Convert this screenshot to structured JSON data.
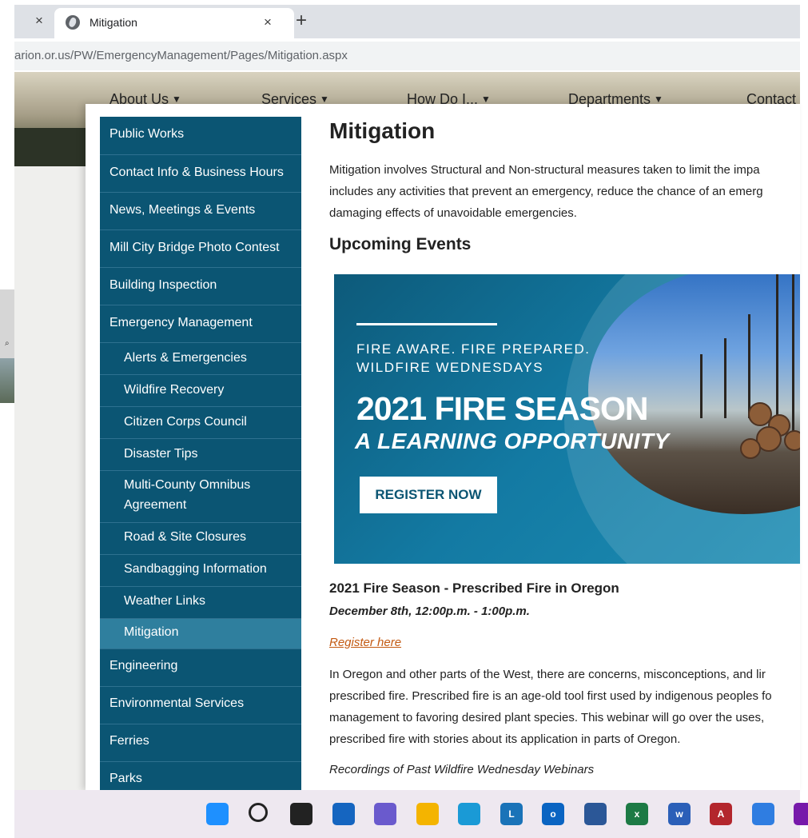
{
  "browser": {
    "tab_title": "Mitigation",
    "close_glyph": "×",
    "new_tab_glyph": "+",
    "url": "arion.or.us/PW/EmergencyManagement/Pages/Mitigation.aspx"
  },
  "topnav": [
    {
      "label": "About Us"
    },
    {
      "label": "Services"
    },
    {
      "label": "How Do I..."
    },
    {
      "label": "Departments"
    },
    {
      "label": "Contact"
    }
  ],
  "nav_caret": "▼",
  "sidebar": {
    "items": [
      {
        "label": "Public Works",
        "level": "top"
      },
      {
        "label": "Contact Info & Business Hours",
        "level": "top"
      },
      {
        "label": "News, Meetings & Events",
        "level": "top"
      },
      {
        "label": "Mill City Bridge Photo Contest",
        "level": "top"
      },
      {
        "label": "Building Inspection",
        "level": "top"
      },
      {
        "label": "Emergency Management",
        "level": "top"
      },
      {
        "label": "Alerts & Emergencies",
        "level": "sub"
      },
      {
        "label": "Wildfire Recovery",
        "level": "sub"
      },
      {
        "label": "Citizen Corps Council",
        "level": "sub"
      },
      {
        "label": "Disaster Tips",
        "level": "sub"
      },
      {
        "label": "Multi-County Omnibus",
        "label2": "Agreement",
        "level": "sub"
      },
      {
        "label": "Road & Site Closures",
        "level": "sub"
      },
      {
        "label": "Sandbagging Information",
        "level": "sub"
      },
      {
        "label": "Weather Links",
        "level": "sub"
      },
      {
        "label": "Mitigation",
        "level": "sub",
        "active": true
      },
      {
        "label": "Engineering",
        "level": "top"
      },
      {
        "label": "Environmental Services",
        "level": "top"
      },
      {
        "label": "Ferries",
        "level": "top"
      },
      {
        "label": "Parks",
        "level": "top"
      }
    ]
  },
  "content": {
    "title": "Mitigation",
    "intro": [
      "Mitigation involves Structural and Non-structural measures taken to limit the impa",
      "includes any activities that prevent an emergency, reduce the chance of an emerg",
      "damaging effects of unavoidable emergencies."
    ],
    "upcoming_heading": "Upcoming Events",
    "banner": {
      "line1": "FIRE AWARE. FIRE PREPARED.",
      "line2": "WILDFIRE WEDNESDAYS",
      "big": "2021 FIRE SEASON",
      "italic": "A LEARNING OPPORTUNITY",
      "button": "REGISTER NOW"
    },
    "event_title": "2021 Fire Season - Prescribed Fire in Oregon",
    "event_date": "December 8th, 12:00p.m. - 1:00p.m.",
    "register_link": "Register here",
    "body": [
      "In Oregon and other parts of the West, there are concerns, misconceptions, and lir",
      "prescribed fire. Prescribed fire is an age-old tool first used by indigenous peoples fo",
      "management to favoring desired plant species. This webinar will go over the uses,",
      "prescribed fire with stories about its application in parts of Oregon."
    ],
    "recordings": "Recordings of Past Wildfire Wednesday Webinars"
  },
  "taskbar": {
    "icons": [
      {
        "name": "windows-start-icon",
        "color": "#1e90ff"
      },
      {
        "name": "search-icon",
        "color": "#222222"
      },
      {
        "name": "task-view-icon",
        "color": "#222222"
      },
      {
        "name": "widgets-icon",
        "color": "#1565c0"
      },
      {
        "name": "chat-icon",
        "color": "#6a5acd"
      },
      {
        "name": "file-explorer-icon",
        "color": "#f4b400"
      },
      {
        "name": "edge-icon",
        "color": "#1a9ad6"
      },
      {
        "name": "l-app-icon",
        "color": "#1a73b8",
        "text": "L"
      },
      {
        "name": "outlook-icon",
        "color": "#0a64c2",
        "text": "o"
      },
      {
        "name": "store-icon",
        "color": "#2b5797"
      },
      {
        "name": "excel-icon",
        "color": "#1d7a45",
        "text": "x"
      },
      {
        "name": "word-icon",
        "color": "#2b5fb8",
        "text": "w"
      },
      {
        "name": "access-icon",
        "color": "#b3262d",
        "text": "A"
      },
      {
        "name": "todo-icon",
        "color": "#2f7de1"
      },
      {
        "name": "onenote-icon",
        "color": "#7719aa"
      }
    ]
  }
}
